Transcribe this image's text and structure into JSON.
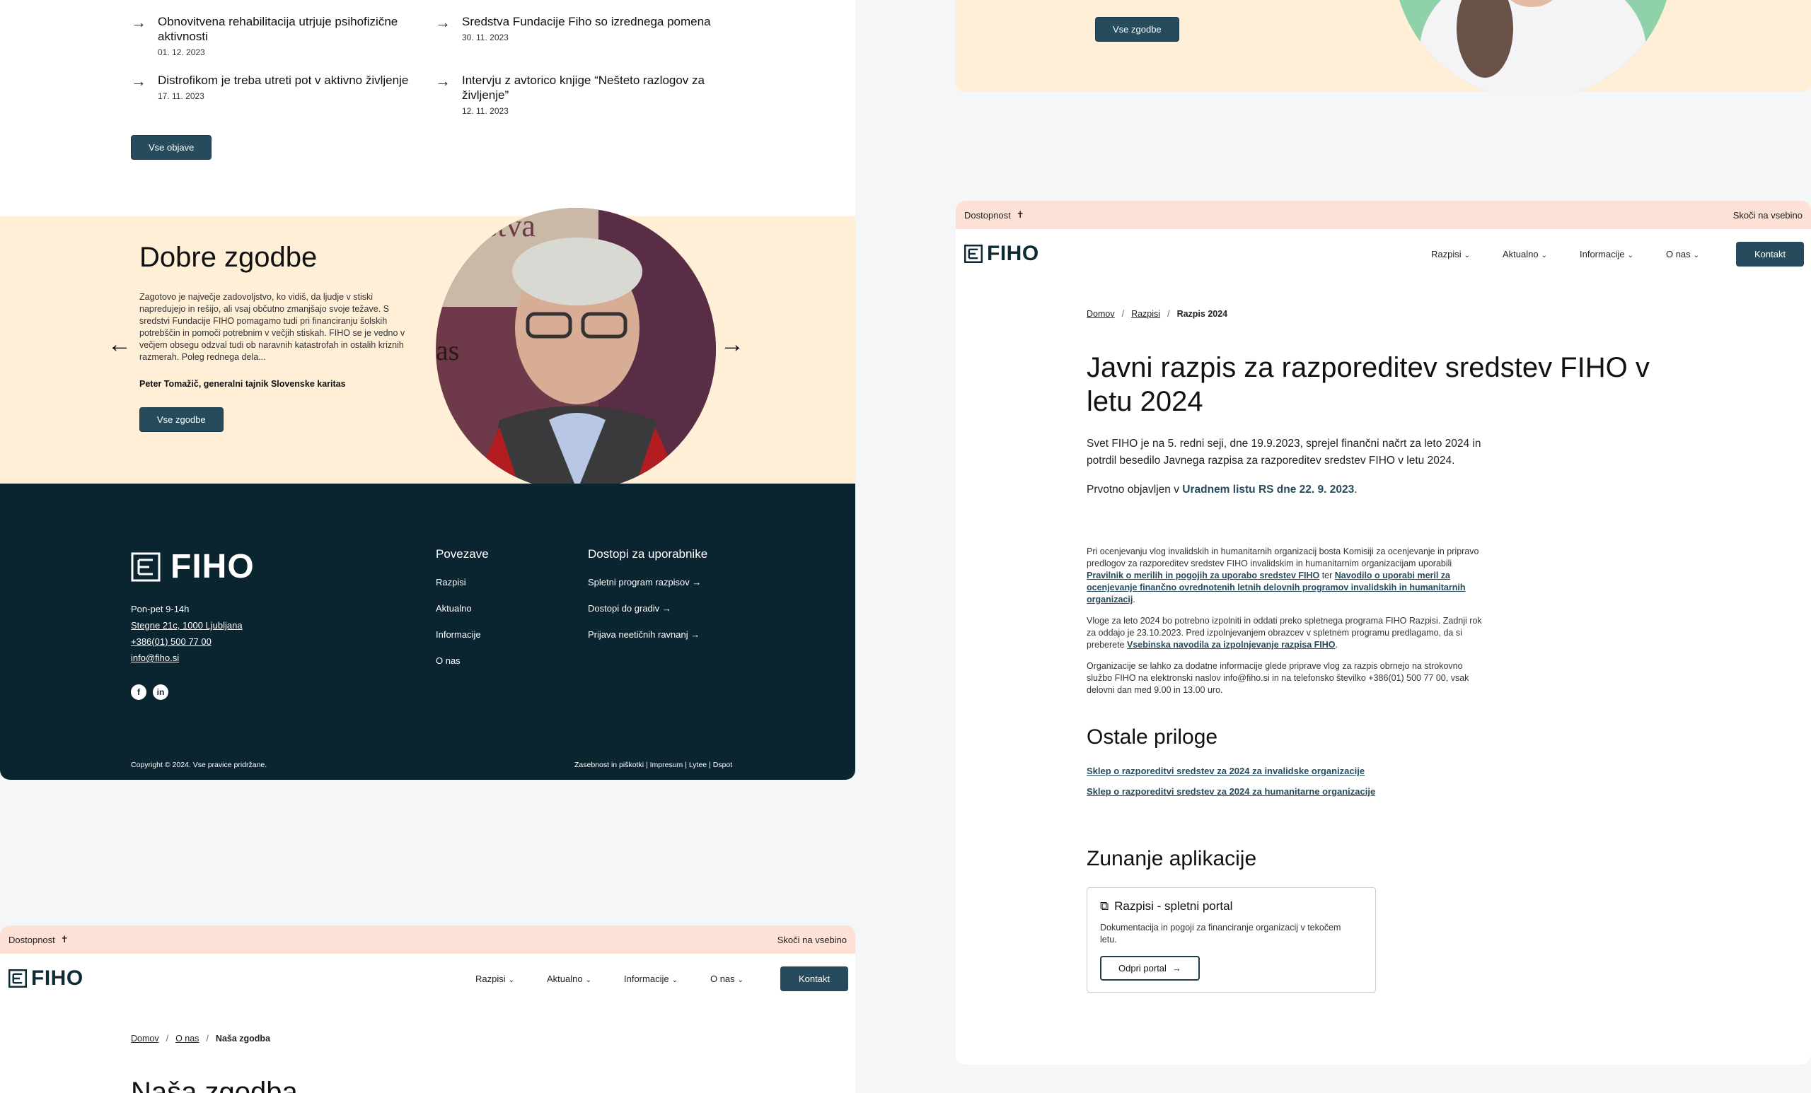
{
  "news": {
    "items": [
      {
        "title": "Obnovitvena rehabilitacija utrjuje psihofizične aktivnosti",
        "date": "01. 12. 2023"
      },
      {
        "title": "Sredstva Fundacije Fiho so izrednega pomena",
        "date": "30. 11. 2023"
      },
      {
        "title": "Distrofikom je treba utreti pot v aktivno življenje",
        "date": "17. 11. 2023"
      },
      {
        "title": "Intervju z avtorico knjige “Nešteto razlogov za življenje”",
        "date": "12. 11. 2023"
      }
    ],
    "all_button": "Vse objave"
  },
  "stories": {
    "title": "Dobre zgodbe",
    "text": "Zagotovo je največje zadovoljstvo, ko vidiš, da ljudje v stiski napredujejo in rešijo, ali vsaj občutno zmanjšajo svoje težave. S sredstvi Fundacije FIHO pomagamo tudi pri financiranju šolskih potrebščin in pomoči potrebnim v večjih stiskah. FIHO se je vedno v večjem obsegu odzval tudi ob naravnih katastrofah in ostalih kriznih razmerah. Poleg rednega dela...",
    "author": "Peter Tomažič, generalni tajnik Slovenske karitas",
    "button": "Vse zgodbe",
    "prev_icon": "arrow-left",
    "next_icon": "arrow-right",
    "photo_sign_text_1": "stva",
    "photo_sign_text_2": "as"
  },
  "footer": {
    "logo_text": "FIHO",
    "hours": "Pon-pet 9-14h",
    "address": "Stegne 21c, 1000 Ljubljana",
    "phone": "+386(01) 500 77 00",
    "email": "info@fiho.si",
    "social": [
      "f",
      "in"
    ],
    "links_title": "Povezave",
    "links": [
      "Razpisi",
      "Aktualno",
      "Informacije",
      "O nas"
    ],
    "access_title": "Dostopi za uporabnike",
    "access_links": [
      "Spletni program razpisov",
      "Dostopi do gradiv",
      "Prijava neetičnih ravnanj"
    ],
    "copyright": "Copyright © 2024. Vse pravice pridržane.",
    "legal": "Zasebnost in piškotki | Impresum | Lytee | Dspot"
  },
  "header": {
    "accessibility": "Dostopnost",
    "skip": "Skoči na vsebino",
    "logo_text": "FIHO",
    "menu": [
      "Razpisi",
      "Aktualno",
      "Informacije",
      "O nas"
    ],
    "contact": "Kontakt"
  },
  "page_zgodba": {
    "crumbs": [
      "Domov",
      "O nas",
      "Naša zgodba"
    ],
    "title": "Naša zgodba"
  },
  "top_right": {
    "button": "Vse zgodbe"
  },
  "page_razpis": {
    "crumbs": [
      "Domov",
      "Razpisi",
      "Razpis 2024"
    ],
    "title": "Javni razpis za razporeditev sredstev FIHO v letu 2024",
    "lead": "Svet FIHO je na 5. redni seji, dne 19.9.2023, sprejel finančni načrt za leto 2024 in potrdil besedilo Javnega razpisa za razporeditev sredstev FIHO v letu 2024.",
    "published_prefix": "Prvotno objavljen v ",
    "published_link": "Uradnem listu RS dne 22. 9. 2023",
    "published_suffix": ".",
    "p1_a": "Pri ocenjevanju vlog invalidskih in humanitarnih organizacij bosta Komisiji za ocenjevanje in pripravo predlogov za razporeditev sredstev FIHO invalidskim in humanitarnim organizacijam uporabili ",
    "p1_link1": "Pravilnik o merilih in pogojih za uporabo sredstev FIHO",
    "p1_b": " ter ",
    "p1_link2": "Navodilo o uporabi meril za ocenjevanje finančno ovrednotenih letnih delovnih programov invalidskih in humanitarnih organizacij",
    "p1_c": ".",
    "p2_a": "Vloge za leto 2024 bo potrebno izpolniti in oddati preko spletnega programa FIHO Razpisi. Zadnji rok za oddajo je 23.10.2023. Pred izpolnjevanjem obrazcev v spletnem programu predlagamo, da si preberete ",
    "p2_link": "Vsebinska navodila za izpolnjevanje razpisa FIHO",
    "p2_b": ".",
    "p3": "Organizacije se lahko za dodatne informacije glede priprave vlog za razpis obrnejo na strokovno službo FIHO na elektronski naslov info@fiho.si in na telefonsko številko +386(01) 500 77 00, vsak delovni dan med 9.00 in 13.00 uro.",
    "attach_title": "Ostale priloge",
    "attachments": [
      "Sklep o razporeditvi sredstev za 2024 za invalidske organizacije",
      "Sklep o razporeditvi sredstev za 2024 za humanitarne organizacije"
    ],
    "apps_title": "Zunanje aplikacije",
    "card_title": "Razpisi - spletni portal",
    "card_desc": "Dokumentacija in pogoji za financiranje organizacij v tekočem letu.",
    "card_button": "Odpri portal"
  },
  "colors": {
    "brand_dark": "#0a2530",
    "button": "#264b5d",
    "cream": "#feefd6",
    "access_bar": "#fde0d6"
  }
}
